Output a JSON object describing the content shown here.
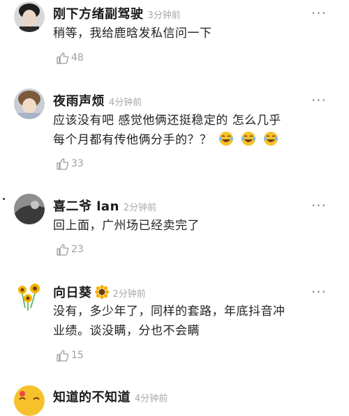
{
  "comments": [
    {
      "name": "刚下方绪副驾驶",
      "time": "3分钟前",
      "lines": [
        "稍等，我给鹿晗发私信问一下"
      ],
      "likes": "48"
    },
    {
      "name": "夜雨声烦",
      "time": "4分钟前",
      "lines": [
        "应该没有吧 感觉他俩还挺稳定的 怎么几乎",
        "每个月都有传他俩分手的？？"
      ],
      "likes": "33"
    },
    {
      "name": "喜二爷 lan",
      "time": "2分钟前",
      "lines": [
        "回上面，广州场已经卖完了"
      ],
      "likes": "23"
    },
    {
      "name": "向日葵",
      "time": "2分钟前",
      "lines": [
        "没有，多少年了，同样的套路，年底抖音冲",
        "业绩。谈没瞒，分也不会瞒"
      ],
      "likes": "15"
    },
    {
      "name": "知道的不知道",
      "time": "4分钟前"
    }
  ],
  "more_label": "···",
  "icons": {
    "like": "thumbs-up-icon",
    "more": "more-dots-icon",
    "emoji": "laughing-tears-emoji",
    "sunflower": "sunflower-emoji"
  }
}
